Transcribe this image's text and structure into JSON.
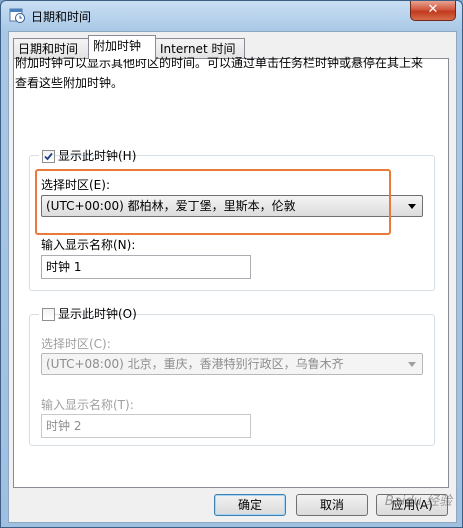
{
  "window": {
    "title": "日期和时间",
    "close_glyph": "✕"
  },
  "tabs": [
    {
      "label": "日期和时间",
      "active": false
    },
    {
      "label": "附加时钟",
      "active": true
    },
    {
      "label": "Internet 时间",
      "active": false
    }
  ],
  "description": "附加时钟可以显示其他时区的时间。可以通过单击任务栏时钟或悬停在其上来查看这些附加时钟。",
  "clock1": {
    "show_label": "显示此时钟(H)",
    "checked": true,
    "timezone_label": "选择时区(E):",
    "timezone_value": "(UTC+00:00) 都柏林，爱丁堡，里斯本，伦敦",
    "name_label": "输入显示名称(N):",
    "name_value": "时钟 1"
  },
  "clock2": {
    "show_label": "显示此时钟(O)",
    "checked": false,
    "timezone_label": "选择时区(C):",
    "timezone_value": "(UTC+08:00) 北京，重庆，香港特别行政区，乌鲁木齐",
    "name_label": "输入显示名称(T):",
    "name_value": "时钟 2"
  },
  "buttons": {
    "ok": "确定",
    "cancel": "取消",
    "apply": "应用(A)"
  },
  "watermark": "Baidu 经验",
  "icons": {
    "app": "clock-calendar-icon",
    "check": "checkmark-icon",
    "dropdown": "chevron-down-icon"
  },
  "colors": {
    "highlight": "#e87a3c",
    "titlebar": "#a9c8e6",
    "close": "#c13a1d"
  }
}
